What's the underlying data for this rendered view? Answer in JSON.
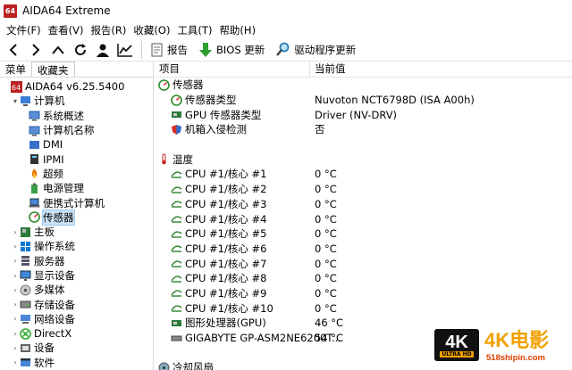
{
  "window": {
    "title": "AIDA64 Extreme",
    "icon_text": "64"
  },
  "menu": [
    "文件(F)",
    "查看(V)",
    "报告(R)",
    "收藏(O)",
    "工具(T)",
    "帮助(H)"
  ],
  "toolbar": {
    "report": "报告",
    "bios_update": "BIOS 更新",
    "driver_update": "驱动程序更新"
  },
  "left_tabs": [
    "菜单",
    "收藏夹"
  ],
  "tree": [
    {
      "label": "AIDA64 v6.25.5400",
      "level": 0,
      "icon": "aida64-icon",
      "exp": ""
    },
    {
      "label": "计算机",
      "level": 1,
      "icon": "computer-icon",
      "exp": "▾"
    },
    {
      "label": "系统概述",
      "level": 2,
      "icon": "summary-icon",
      "exp": ""
    },
    {
      "label": "计算机名称",
      "level": 2,
      "icon": "computer-name-icon",
      "exp": ""
    },
    {
      "label": "DMI",
      "level": 2,
      "icon": "dmi-icon",
      "exp": ""
    },
    {
      "label": "IPMI",
      "level": 2,
      "icon": "ipmi-icon",
      "exp": ""
    },
    {
      "label": "超频",
      "level": 2,
      "icon": "overclock-icon",
      "exp": ""
    },
    {
      "label": "电源管理",
      "level": 2,
      "icon": "power-icon",
      "exp": ""
    },
    {
      "label": "便携式计算机",
      "level": 2,
      "icon": "laptop-icon",
      "exp": ""
    },
    {
      "label": "传感器",
      "level": 2,
      "icon": "sensor-icon",
      "exp": "",
      "selected": true
    },
    {
      "label": "主板",
      "level": 1,
      "icon": "motherboard-icon",
      "exp": "›"
    },
    {
      "label": "操作系统",
      "level": 1,
      "icon": "windows-icon",
      "exp": "›"
    },
    {
      "label": "服务器",
      "level": 1,
      "icon": "server-icon",
      "exp": "›"
    },
    {
      "label": "显示设备",
      "level": 1,
      "icon": "display-icon",
      "exp": "›"
    },
    {
      "label": "多媒体",
      "level": 1,
      "icon": "multimedia-icon",
      "exp": "›"
    },
    {
      "label": "存储设备",
      "level": 1,
      "icon": "storage-icon",
      "exp": "›"
    },
    {
      "label": "网络设备",
      "level": 1,
      "icon": "network-icon",
      "exp": "›"
    },
    {
      "label": "DirectX",
      "level": 1,
      "icon": "directx-icon",
      "exp": "›"
    },
    {
      "label": "设备",
      "level": 1,
      "icon": "devices-icon",
      "exp": "›"
    },
    {
      "label": "软件",
      "level": 1,
      "icon": "software-icon",
      "exp": "›"
    }
  ],
  "columns": {
    "item": "项目",
    "value": "当前值"
  },
  "rows": [
    {
      "type": "section",
      "label": "传感器",
      "value": "",
      "icon": "sensor-icon"
    },
    {
      "type": "item",
      "label": "传感器类型",
      "value": "Nuvoton NCT6798D  (ISA A00h)",
      "icon": "sensor-icon"
    },
    {
      "type": "item",
      "label": "GPU 传感器类型",
      "value": "Driver  (NV-DRV)",
      "icon": "gpu-icon"
    },
    {
      "type": "item",
      "label": "机箱入侵检测",
      "value": "否",
      "icon": "shield-icon"
    },
    {
      "type": "blank",
      "label": "",
      "value": ""
    },
    {
      "type": "section",
      "label": "温度",
      "value": "",
      "icon": "thermometer-icon"
    },
    {
      "type": "item",
      "label": "CPU #1/核心 #1",
      "value": "0 °C",
      "icon": "cpu-core-icon"
    },
    {
      "type": "item",
      "label": "CPU #1/核心 #2",
      "value": "0 °C",
      "icon": "cpu-core-icon"
    },
    {
      "type": "item",
      "label": "CPU #1/核心 #3",
      "value": "0 °C",
      "icon": "cpu-core-icon"
    },
    {
      "type": "item",
      "label": "CPU #1/核心 #4",
      "value": "0 °C",
      "icon": "cpu-core-icon"
    },
    {
      "type": "item",
      "label": "CPU #1/核心 #5",
      "value": "0 °C",
      "icon": "cpu-core-icon"
    },
    {
      "type": "item",
      "label": "CPU #1/核心 #6",
      "value": "0 °C",
      "icon": "cpu-core-icon"
    },
    {
      "type": "item",
      "label": "CPU #1/核心 #7",
      "value": "0 °C",
      "icon": "cpu-core-icon"
    },
    {
      "type": "item",
      "label": "CPU #1/核心 #8",
      "value": "0 °C",
      "icon": "cpu-core-icon"
    },
    {
      "type": "item",
      "label": "CPU #1/核心 #9",
      "value": "0 °C",
      "icon": "cpu-core-icon"
    },
    {
      "type": "item",
      "label": "CPU #1/核心 #10",
      "value": "0 °C",
      "icon": "cpu-core-icon"
    },
    {
      "type": "item",
      "label": "图形处理器(GPU)",
      "value": "46 °C",
      "icon": "gpu-icon"
    },
    {
      "type": "item",
      "label": "GIGABYTE GP-ASM2NE6200T...",
      "value": "54 °C",
      "icon": "ssd-icon"
    },
    {
      "type": "blank",
      "label": "",
      "value": ""
    },
    {
      "type": "section",
      "label": "冷却风扇",
      "value": "",
      "icon": "fan-icon"
    }
  ],
  "watermark": {
    "badge": "4K",
    "badge_sub": "ULTRA HD",
    "brand": "4K电影",
    "url": "518shipin.com"
  }
}
